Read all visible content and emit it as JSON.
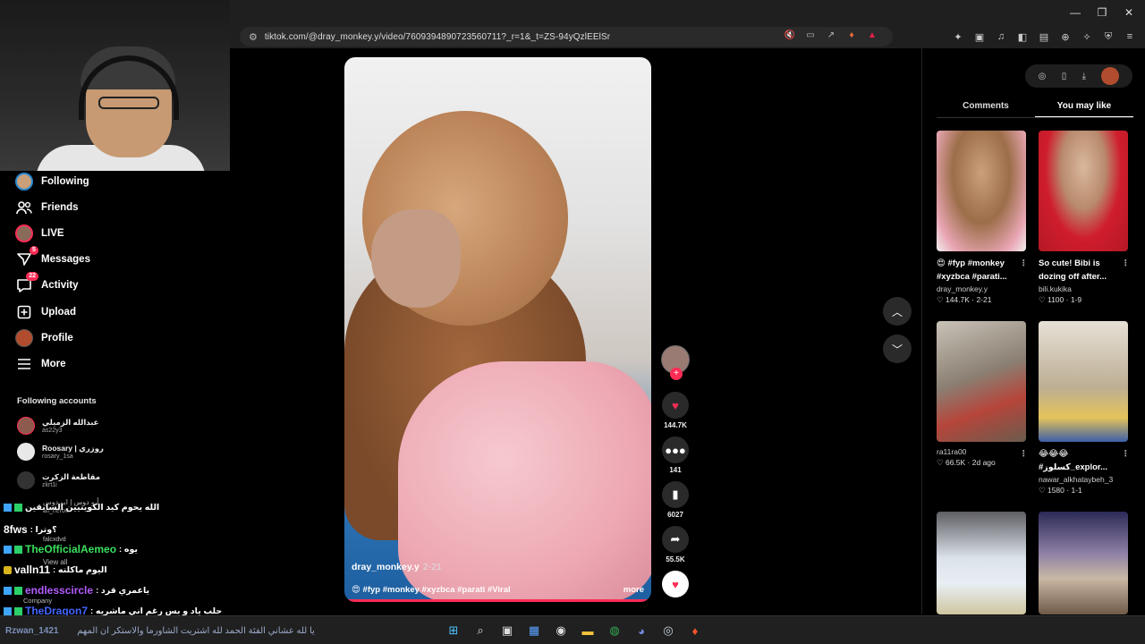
{
  "browser": {
    "url": "tiktok.com/@dray_monkey.y/video/7609394890723560711?_r=1&_t=ZS-94yQzlEElSr",
    "window_controls": [
      "—",
      "❐",
      "✕"
    ]
  },
  "sidebar": {
    "nav": [
      {
        "label": "Following",
        "icon": "following-avatar-icon"
      },
      {
        "label": "Friends",
        "icon": "friends-icon"
      },
      {
        "label": "LIVE",
        "icon": "live-icon"
      },
      {
        "label": "Messages",
        "icon": "messages-icon",
        "badge": "5"
      },
      {
        "label": "Activity",
        "icon": "activity-icon",
        "badge": "22"
      },
      {
        "label": "Upload",
        "icon": "upload-icon"
      },
      {
        "label": "Profile",
        "icon": "profile-avatar-icon"
      },
      {
        "label": "More",
        "icon": "more-icon"
      }
    ],
    "following_title": "Following accounts",
    "accounts": [
      {
        "name": "عبدالله الزميلي",
        "handle": "as22y3"
      },
      {
        "name": "Roosary | روزري",
        "handle": "rosary_1sa"
      },
      {
        "name": "مقاطعة الزكرت",
        "handle": "zkrt1i"
      }
    ]
  },
  "chat": {
    "messages": [
      {
        "user": "",
        "text": "الله يحوم كيد الكويتيين السابقين",
        "color": "white"
      },
      {
        "user": "8fws",
        "text": ": ؟وترا",
        "color": "white"
      },
      {
        "user": "TheOfficialAemeo",
        "text": ": يوه",
        "color": "green"
      },
      {
        "user": "valln11",
        "text": ": اليوم ماكلته",
        "color": "white"
      },
      {
        "user": "endlesscircle",
        "text": ": ياعمري قرد",
        "color": "purple"
      },
      {
        "user": "TheDragon7",
        "text": ": حلب ياد و بس رغم اني ماشريه",
        "color": "blue"
      }
    ],
    "ghost": {
      "al_hero": "ali_hero0",
      "falc": "falcxdvd",
      "view_all": "View all",
      "company": "Company",
      "abo_dos": "أبو دوس | ابو دوس"
    }
  },
  "video": {
    "author": "dray_monkey.y",
    "date": "2-21",
    "tags": "😍 #fyp #monkey #xyzbca #parati #Viral",
    "more": "more"
  },
  "actions": {
    "likes": "144.7K",
    "comments": "141",
    "saves": "6027",
    "shares": "55.5K"
  },
  "right_panel": {
    "tabs": [
      "Comments",
      "You may like"
    ],
    "active_tab": 1,
    "cards": [
      {
        "title": "😍 #fyp #monkey #xyzbca #parati...",
        "author": "dray_monkey.y",
        "meta": "♡ 144.7K · 2-21"
      },
      {
        "title": "So cute! Bibi is dozing off after...",
        "author": "bili.kukika",
        "meta": "♡ 1100 · 1-9"
      },
      {
        "title": "",
        "author": "ra11ra00",
        "meta": "♡ 66.5K · 2d ago"
      },
      {
        "title": "😂😂😂 #كسلوز_explor...",
        "author": "nawar_alkhataybeh_3",
        "meta": "♡ 1580 · 1-1"
      },
      {
        "title": "",
        "author": "",
        "meta": ""
      },
      {
        "title": "",
        "author": "",
        "meta": ""
      }
    ]
  },
  "taskbar": {
    "user": "Rzwan_1421",
    "text": "يا لله عشاني الفئة الحمد لله اشتريت الشاورما والاستكر ان المهم",
    "clock_time": "",
    "clock_date": ""
  },
  "colors": {
    "accent": "#fe2c55",
    "background": "#000000",
    "sidebar_blue": "#2b8bd1"
  }
}
